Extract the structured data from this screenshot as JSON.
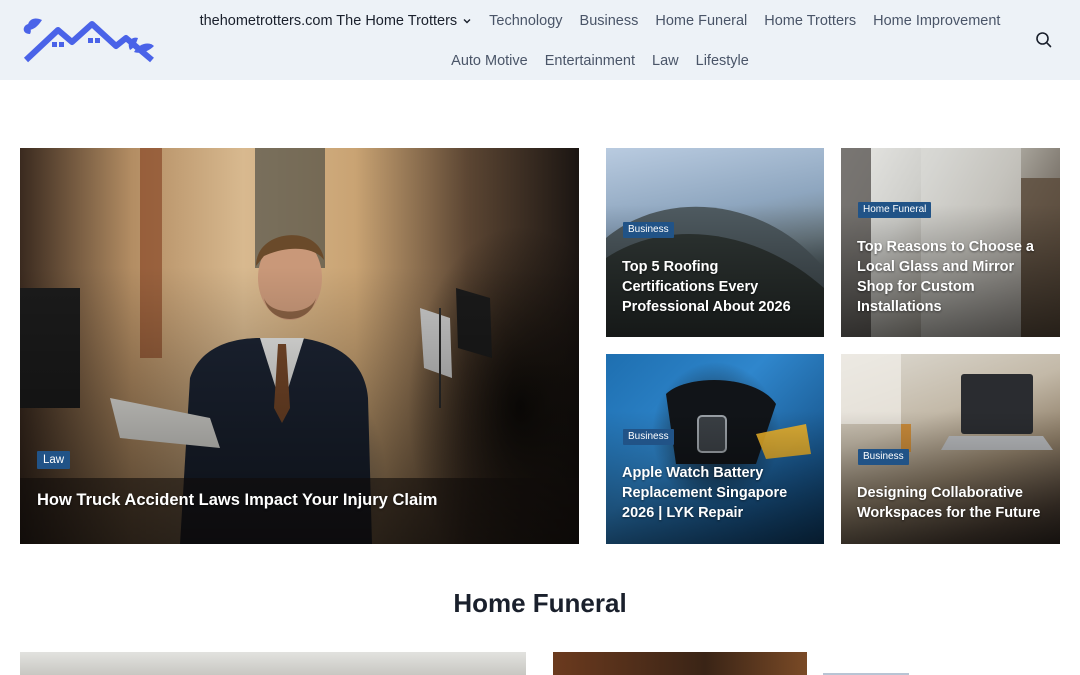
{
  "header": {
    "site_logo": "house-roof-leaves-logo",
    "nav_row1": [
      {
        "label": "thehometrotters.com The Home Trotters",
        "has_dropdown": true
      },
      {
        "label": "Technology"
      },
      {
        "label": "Business"
      },
      {
        "label": "Home Funeral"
      },
      {
        "label": "Home Trotters"
      },
      {
        "label": "Home Improvement"
      }
    ],
    "nav_row2": [
      {
        "label": "Auto Motive"
      },
      {
        "label": "Entertainment"
      },
      {
        "label": "Law"
      },
      {
        "label": "Lifestyle"
      }
    ],
    "search_icon": "search-icon"
  },
  "featured": {
    "hero": {
      "category": "Law",
      "title": "How Truck Accident Laws Impact Your Injury Claim"
    },
    "cards": [
      {
        "category": "Business",
        "title": "Top 5 Roofing Certifications Every Professional About 2026"
      },
      {
        "category": "Home Funeral",
        "title": "Top Reasons to Choose a Local Glass and Mirror Shop for Custom Installations"
      },
      {
        "category": "Business",
        "title": "Apple Watch Battery Replacement Singapore 2026 | LYK Repair"
      },
      {
        "category": "Business",
        "title": "Designing Collaborative Workspaces for the Future"
      }
    ]
  },
  "section": {
    "title": "Home Funeral"
  },
  "colors": {
    "header_bg": "#edf2f7",
    "badge_bg": "#215387",
    "logo_blue": "#4a63e8",
    "text_dark": "#1a202c",
    "nav_text": "#4a5568"
  }
}
